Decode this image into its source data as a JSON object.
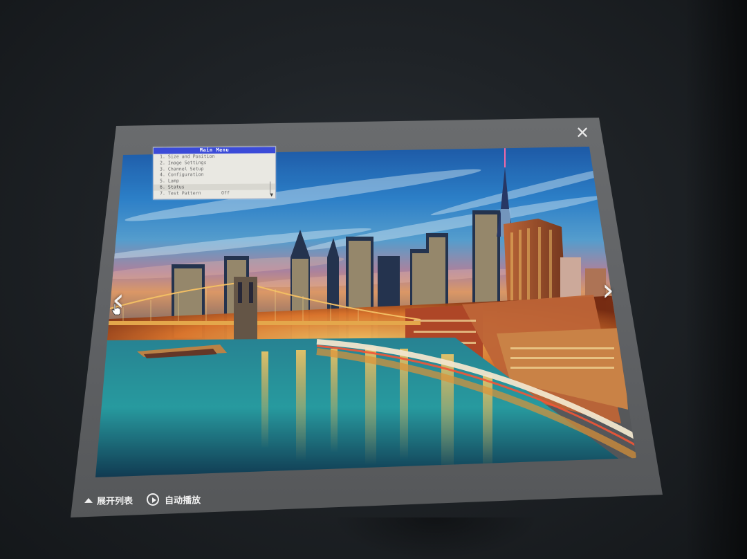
{
  "viewer": {
    "close_symbol": "✕",
    "prev_symbol": "‹",
    "next_symbol": "›",
    "photo_name": "city-skyline-night-photo"
  },
  "osd_menu": {
    "title": "Main Menu",
    "items": [
      {
        "label": "1. Size and Position",
        "value": ""
      },
      {
        "label": "2. Image Settings",
        "value": ""
      },
      {
        "label": "3. Channel Setup",
        "value": ""
      },
      {
        "label": "4. Configuration",
        "value": ""
      },
      {
        "label": "5. Lamp",
        "value": ""
      },
      {
        "label": "6. Status",
        "value": ""
      },
      {
        "label": "7. Test Pattern",
        "value": "Off"
      }
    ]
  },
  "footer": {
    "expand_list_label": "展开列表",
    "autoplay_label": "自动播放"
  },
  "colors": {
    "osd_title_bg": "#3b4bd8",
    "panel_bg": "#5e6063",
    "room_bg": "#1f2327"
  }
}
